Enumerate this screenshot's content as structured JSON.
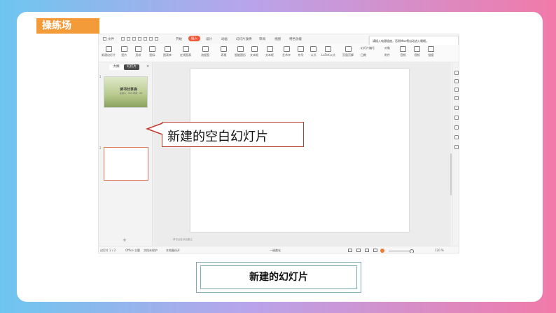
{
  "practice_label": "操练场",
  "menu": {
    "file": "文件",
    "tabs": [
      "开始",
      "插入",
      "设计",
      "动画",
      "幻灯片放映",
      "审阅",
      "视图",
      "特色功能"
    ],
    "active_tab_index": 1
  },
  "tooltip_text": "请插入电源插座，否则Mac将自动进入睡眠。",
  "ribbon": [
    "新建幻灯片",
    "图片",
    "形状",
    "图标",
    "图表库",
    "在线图表",
    "流程图",
    "表格",
    "智能图形",
    "文本框",
    "文本框",
    "艺术字",
    "符号",
    "公式",
    "LaTeX公式",
    "页眉页脚",
    "幻灯片编号",
    "日期",
    "对象",
    "附件",
    "音频",
    "视频",
    "链接"
  ],
  "panel": {
    "tab_outline": "大纲",
    "tab_slides": "幻灯片",
    "slide1_number": "1",
    "slide1_title": "读书分享会",
    "slide1_subtitle": "主讲人：XXX  时间：XX",
    "slide2_number": "2",
    "add_symbol": "+"
  },
  "notes_placeholder": "单击此处添加备注",
  "status": {
    "slide_counter": "幻灯片 2 / 2",
    "theme": "Office 主题",
    "protect": "文档未保护",
    "backup": "本地备份开",
    "beautify": "一键美化",
    "zoom": "120 %"
  },
  "callout_text": "新建的空白幻灯片",
  "caption_text": "新建的幻灯片",
  "colors": {
    "accent_orange": "#f29b38",
    "active_tab": "#f15a3a",
    "callout_border": "#c0392b",
    "caption_border": "#7fa9b3"
  }
}
